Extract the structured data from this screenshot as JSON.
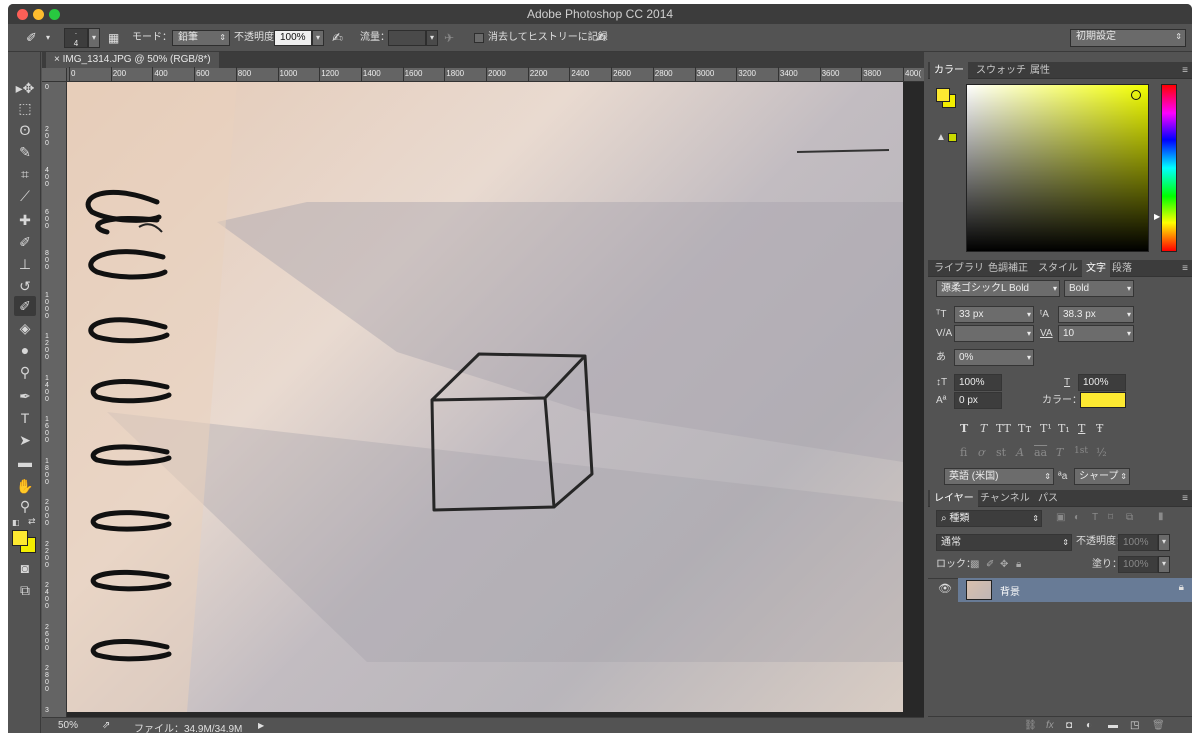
{
  "window": {
    "title": "Adobe Photoshop CC 2014"
  },
  "options": {
    "brush_size": "4",
    "mode_label": "モード：",
    "mode_value": "鉛筆",
    "opacity_label": "不透明度：",
    "opacity_value": "100%",
    "flow_label": "流量：",
    "erase_history_label": "消去してヒストリーに記録",
    "workspace": "初期設定"
  },
  "document": {
    "tab_title": "IMG_1314.JPG @ 50% (RGB/8*)",
    "ruler_h": [
      "0",
      "200",
      "400",
      "600",
      "800",
      "1000",
      "1200",
      "1400",
      "1600",
      "1800",
      "2000",
      "2200",
      "2400",
      "2600",
      "2800",
      "3000",
      "3200",
      "3400",
      "3600",
      "3800",
      "400("
    ],
    "ruler_v": [
      "0",
      "200",
      "400",
      "600",
      "800",
      "1000",
      "1200",
      "1400",
      "1600",
      "1800",
      "2000",
      "2200",
      "2400",
      "2600",
      "2800",
      "3"
    ],
    "zoom": "50%",
    "file_info": "ファイル：34.9M/34.9M"
  },
  "colors": {
    "foreground": "#fde931",
    "background": "#f3ee00",
    "picker_hue": "#f3ff00",
    "text_color": "#fde931",
    "layer_selected": "#687b96"
  },
  "color_panel": {
    "tabs": [
      "カラー",
      "スウォッチ",
      "属性"
    ]
  },
  "char_panel": {
    "tabs": [
      "ライブラリ",
      "色調補正",
      "スタイル",
      "文字",
      "段落"
    ],
    "font_family": "源柔ゴシックL Bold",
    "font_style": "Bold",
    "font_size": "33 px",
    "leading": "38.3 px",
    "tracking": "10",
    "tsume": "0%",
    "vertical_scale": "100%",
    "horizontal_scale": "100%",
    "baseline_shift": "0 px",
    "color_label": "カラー：",
    "style_glyphs": [
      "T",
      "T",
      "TT",
      "Tт",
      "T¹",
      "T₁",
      "T",
      "Ŧ"
    ],
    "opentype_glyphs": [
      "fi",
      "ơ",
      "st",
      "A",
      "aa",
      "T",
      "1st",
      "½"
    ],
    "language": "英語 (米国)",
    "aa_label": "ªa",
    "antialias": "シャープ"
  },
  "layers_panel": {
    "tabs": [
      "レイヤー",
      "チャンネル",
      "パス"
    ],
    "filter_kind": "種類",
    "blend_mode": "通常",
    "opacity_label": "不透明度：",
    "opacity_value": "100%",
    "lock_label": "ロック：",
    "fill_label": "塗り：",
    "fill_value": "100%",
    "layers": [
      {
        "name": "背景",
        "visible": true,
        "locked": true
      }
    ]
  }
}
